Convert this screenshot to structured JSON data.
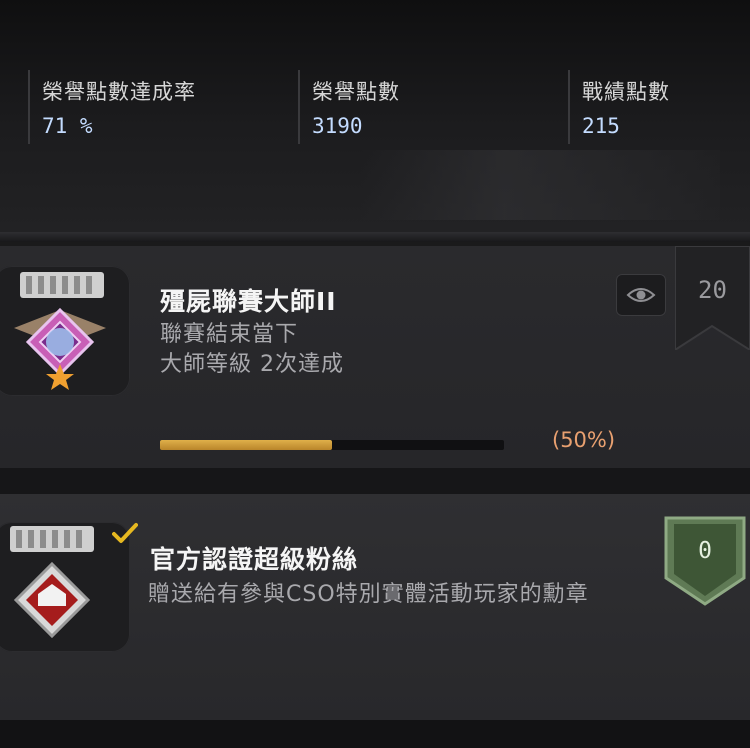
{
  "stats": [
    {
      "label": "榮譽點數達成率",
      "value": "71 %"
    },
    {
      "label": "榮譽點數",
      "value": "3190"
    },
    {
      "label": "戰績點數",
      "value": "215"
    }
  ],
  "achievements": [
    {
      "title": "殭屍聯賽大師II",
      "desc_lines": [
        "聯賽結束當下",
        "大師等級 2次達成"
      ],
      "progress_fraction": 0.5,
      "progress_text": "(50%)",
      "reward_points": "20",
      "icons": [
        "eye-icon",
        "medal-purple-icon"
      ]
    },
    {
      "title": "官方認證超級粉絲",
      "desc": "贈送給有參與CSO特別實體活動玩家的勳章",
      "reward_points": "0",
      "completed": true,
      "icons": [
        "checkmark-icon",
        "medal-red-icon",
        "shield-badge-icon"
      ]
    }
  ],
  "colors": {
    "progress_fill": "#d4a23f",
    "progress_text": "#e8a070",
    "stat_value": "#c4dcff",
    "shield_badge": "#5f7a55"
  }
}
